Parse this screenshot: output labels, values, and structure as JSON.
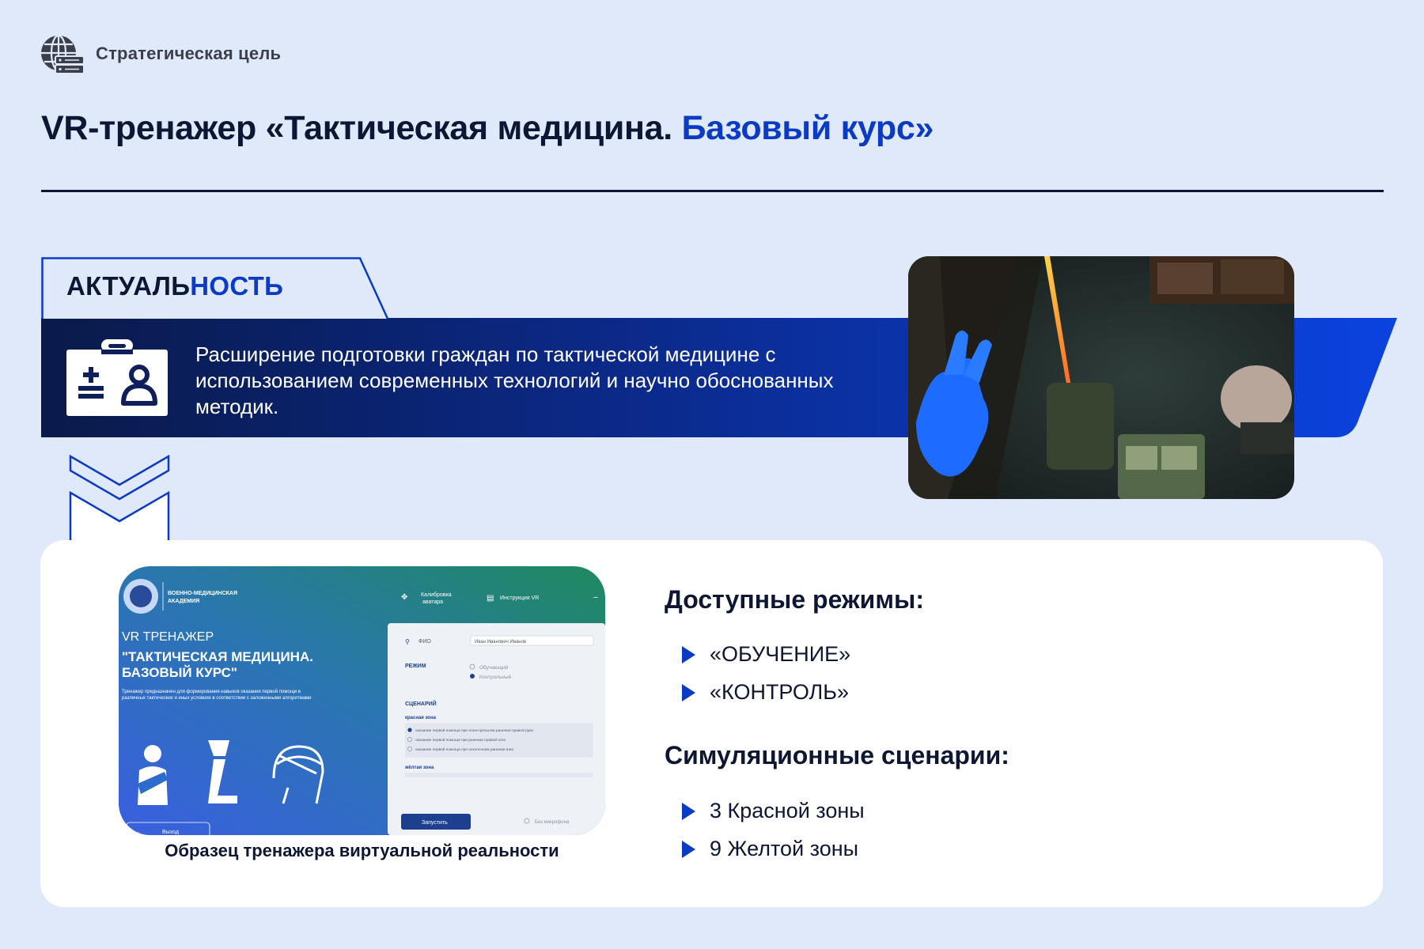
{
  "header": {
    "section_label": "Стратегическая цель",
    "title_part1": "VR-тренажер «Тактическая медицина.",
    "title_part2": "Базовый курс»"
  },
  "relevance": {
    "tab_part1": "АКТУАЛЬ",
    "tab_part2": "НОСТЬ",
    "text": "Расширение подготовки граждан по тактической медицине с использованием современных технологий и научно обоснованных методик."
  },
  "sample": {
    "caption": "Образец тренажера виртуальной реальности",
    "app": {
      "org_line1": "ВОЕННО-МЕДИЦИНСКАЯ",
      "org_line2": "АКАДЕМИЯ",
      "calibration_line1": "Калибровка",
      "calibration_line2": "аватара",
      "instruction": "Инструкция VR",
      "heading_small": "VR ТРЕНАЖЕР",
      "heading_line1": "\"ТАКТИЧЕСКАЯ МЕДИЦИНА.",
      "heading_line2": "БАЗОВЫЙ КУРС\"",
      "description": "Тренажер предназначен для формирования навыков оказания первой помощи в различных тактических и иных условиях в соответствии с заложенными алгоритмами",
      "exit": "Выход",
      "fio_label": "ФИО",
      "fio_value": "Иван Иванович Иванов",
      "mode_label": "РЕЖИМ",
      "mode_options": [
        "Обучающий",
        "Контрольный"
      ],
      "selected_mode": "Контрольный",
      "scenarios_label": "СЦЕНАРИЙ",
      "red_zone": "красная зона",
      "scenario_items": [
        "оказание первой помощи при огнестрельном ранении правой руки",
        "оказание первой помощи при ранении правой ноги",
        "оказание первой помощи при осколочном ранении шеи"
      ],
      "yellow_zone": "жёлтая зона",
      "start_button": "Запустить",
      "mic_option": "Без микрофона"
    }
  },
  "modes": {
    "heading": "Доступные режимы:",
    "items": [
      "«ОБУЧЕНИЕ»",
      "«КОНТРОЛЬ»"
    ]
  },
  "scenarios": {
    "heading": "Симуляционные сценарии:",
    "items": [
      "3 Красной зоны",
      "9 Желтой зоны"
    ]
  },
  "colors": {
    "background": "#e0e9fa",
    "navy": "#0d1633",
    "accent_blue": "#0b3bc4"
  },
  "icons": [
    "globe-server-icon",
    "medical-id-card-icon",
    "chevron-down-icon",
    "arrow-right-icon"
  ]
}
